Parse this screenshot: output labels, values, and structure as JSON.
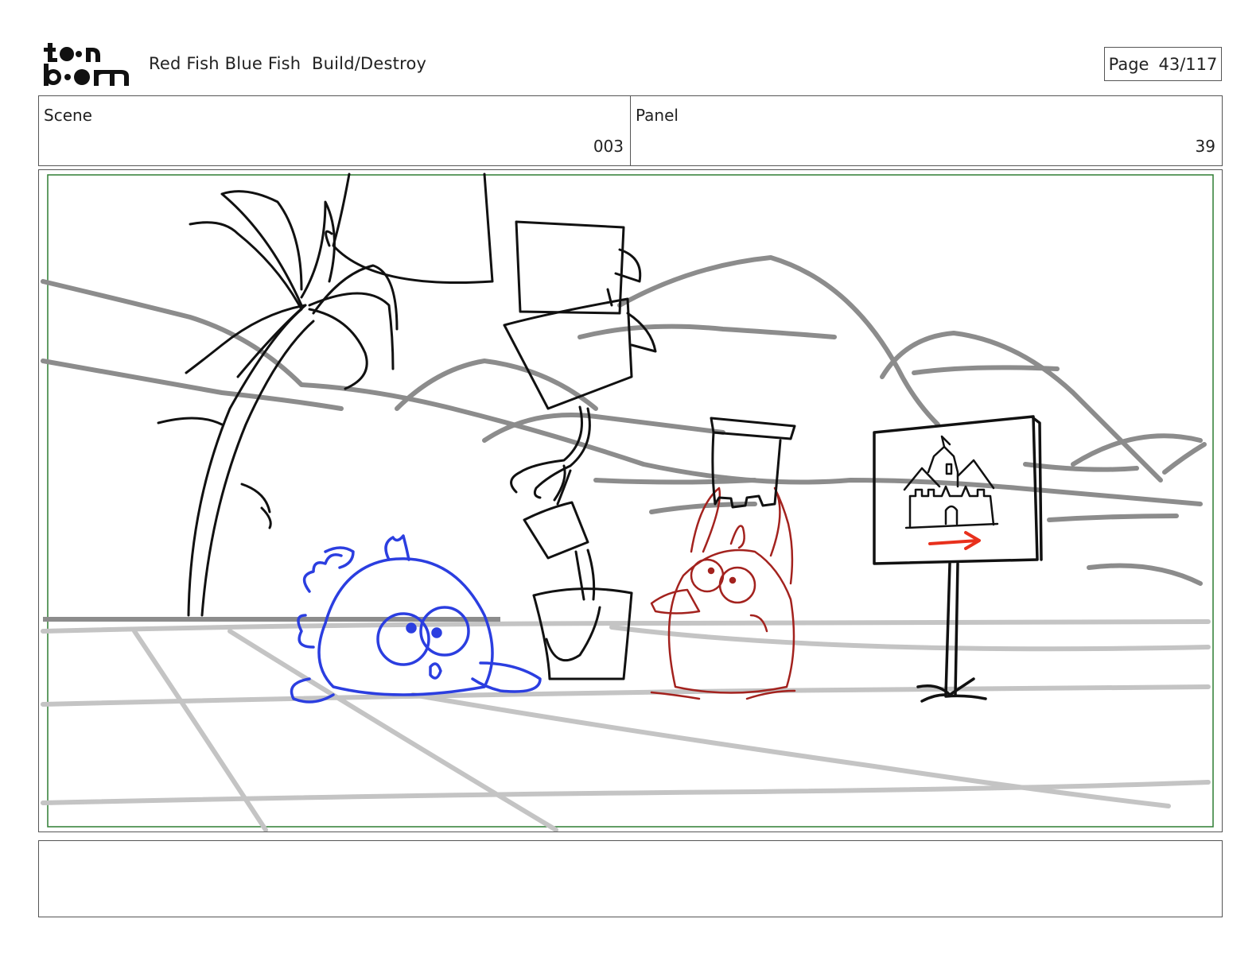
{
  "header": {
    "project_title": "Red Fish Blue Fish  Build/Destroy",
    "page_label": "Page",
    "page_number": "43/117"
  },
  "scene": {
    "label": "Scene",
    "value": "003"
  },
  "panel": {
    "label": "Panel",
    "value": "39"
  },
  "notes": {
    "text": ""
  },
  "colors": {
    "blue_fish": "#2b3ee0",
    "red_fish": "#a3221e",
    "arrow": "#e8301c",
    "safe_frame": "#2e7d32"
  }
}
